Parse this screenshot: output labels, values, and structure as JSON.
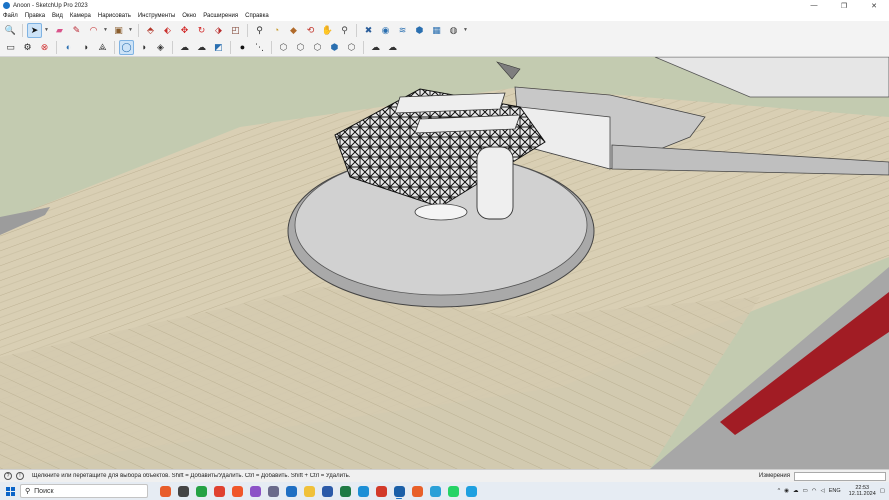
{
  "window": {
    "title": "Anoon - SketchUp Pro 2023",
    "minimize": "—",
    "maximize": "❐",
    "close": "✕"
  },
  "menu": [
    "Файл",
    "Правка",
    "Вид",
    "Камера",
    "Нарисовать",
    "Инструменты",
    "Окно",
    "Расширения",
    "Справка"
  ],
  "toolbar1": [
    {
      "name": "zoom-extents-icon",
      "glyph": "🔍",
      "color": "#333333"
    },
    {
      "name": "select-tool-icon",
      "glyph": "➤",
      "color": "#111111",
      "active": true
    },
    {
      "name": "eraser-icon",
      "glyph": "▰",
      "color": "#d9538a"
    },
    {
      "name": "pencil-line-icon",
      "glyph": "✎",
      "color": "#b8232f"
    },
    {
      "name": "arc-tool-icon",
      "glyph": "◠",
      "color": "#c22a2a"
    },
    {
      "name": "rectangle-tool-icon",
      "glyph": "▣",
      "color": "#8a5d2d"
    },
    {
      "name": "push-pull-icon",
      "glyph": "⬘",
      "color": "#b3372a"
    },
    {
      "name": "follow-me-icon",
      "glyph": "⬖",
      "color": "#c9302c"
    },
    {
      "name": "move-tool-icon",
      "glyph": "✥",
      "color": "#d22a2a"
    },
    {
      "name": "rotate-tool-icon",
      "glyph": "↻",
      "color": "#d22a2a"
    },
    {
      "name": "scale-tool-icon",
      "glyph": "⬗",
      "color": "#b82c2c"
    },
    {
      "name": "offset-tool-icon",
      "glyph": "◰",
      "color": "#7a3b2b"
    },
    {
      "name": "tape-measure-icon",
      "glyph": "⚲",
      "color": "#333333"
    },
    {
      "name": "protractor-icon",
      "glyph": "◔",
      "color": "#c79a2a"
    },
    {
      "name": "paint-bucket-icon",
      "glyph": "◆",
      "color": "#b06a2a"
    },
    {
      "name": "orbit-tool-icon",
      "glyph": "⟲",
      "color": "#c2342a"
    },
    {
      "name": "pan-tool-icon",
      "glyph": "✋",
      "color": "#7a4a2a"
    },
    {
      "name": "zoom-tool-icon",
      "glyph": "⚲",
      "color": "#444444"
    },
    {
      "name": "section-plane-icon",
      "glyph": "✖",
      "color": "#2a5d9a"
    },
    {
      "name": "3d-warehouse-icon",
      "glyph": "◉",
      "color": "#2a6fb0"
    },
    {
      "name": "extension-warehouse-icon",
      "glyph": "≋",
      "color": "#2a6fb0"
    },
    {
      "name": "layout-send-icon",
      "glyph": "⬢",
      "color": "#2a6fb0"
    },
    {
      "name": "extension-manager-icon",
      "glyph": "▦",
      "color": "#2a6fb0"
    },
    {
      "name": "user-account-icon",
      "glyph": "◍",
      "color": "#444444"
    }
  ],
  "toolbar2": [
    {
      "name": "open-folder-icon",
      "glyph": "▭",
      "color": "#333333"
    },
    {
      "name": "settings-gear-icon",
      "glyph": "⚙",
      "color": "#222222"
    },
    {
      "name": "cancel-circle-icon",
      "glyph": "⊗",
      "color": "#d03030"
    },
    {
      "name": "geo-location-icon",
      "glyph": "◐",
      "color": "#2a6fb0"
    },
    {
      "name": "add-location-icon",
      "glyph": "◑",
      "color": "#333333"
    },
    {
      "name": "terrain-icon",
      "glyph": "⟁",
      "color": "#333333"
    },
    {
      "name": "xray-mode-icon",
      "glyph": "◯",
      "color": "#2a6fb0",
      "active": true
    },
    {
      "name": "back-edges-icon",
      "glyph": "◑",
      "color": "#333333"
    },
    {
      "name": "wireframe-icon",
      "glyph": "◈",
      "color": "#333333"
    },
    {
      "name": "upload-cloud-icon",
      "glyph": "☁",
      "color": "#333333"
    },
    {
      "name": "download-cloud-icon",
      "glyph": "☁",
      "color": "#333333"
    },
    {
      "name": "share-model-icon",
      "glyph": "◩",
      "color": "#2a6fb0"
    },
    {
      "name": "point-dot-icon",
      "glyph": "●",
      "color": "#111111"
    },
    {
      "name": "dashed-line-icon",
      "glyph": "⋱",
      "color": "#333333"
    },
    {
      "name": "solid-tools-union-icon",
      "glyph": "⬡",
      "color": "#555555"
    },
    {
      "name": "solid-tools-subtract-icon",
      "glyph": "⬡",
      "color": "#555555"
    },
    {
      "name": "solid-tools-intersect-icon",
      "glyph": "⬡",
      "color": "#555555"
    },
    {
      "name": "solid-tools-trim-icon",
      "glyph": "⬢",
      "color": "#2a6fb0"
    },
    {
      "name": "solid-tools-split-icon",
      "glyph": "⬡",
      "color": "#555555"
    },
    {
      "name": "cloud-sync-icon",
      "glyph": "☁",
      "color": "#333333"
    },
    {
      "name": "cloud-export-icon",
      "glyph": "☁",
      "color": "#333333"
    }
  ],
  "status": {
    "help_icon": "?",
    "info_icon": "!",
    "text": "Щелкните или перетащите для выбора объектов. Shift = Добавить/Удалить. Ctrl = Добавить. Shift + Ctrl = Удалить.",
    "measure_label": "Измерения"
  },
  "taskbar": {
    "search_label": "Поиск",
    "apps": [
      {
        "name": "copilot-app-icon",
        "color": "#e85d2a"
      },
      {
        "name": "task-view-icon",
        "color": "#444444"
      },
      {
        "name": "whatsapp-store-icon",
        "color": "#25a244"
      },
      {
        "name": "chrome-icon",
        "color": "#e0412f"
      },
      {
        "name": "brave-browser-icon",
        "color": "#f0572a"
      },
      {
        "name": "app-purple-icon",
        "color": "#8c52c7"
      },
      {
        "name": "settings-app-icon",
        "color": "#6a6a8a"
      },
      {
        "name": "outlook-icon",
        "color": "#1f6fc3"
      },
      {
        "name": "file-explorer-icon",
        "color": "#f0c13a"
      },
      {
        "name": "word-icon",
        "color": "#2b5aa8"
      },
      {
        "name": "excel-icon",
        "color": "#1f7a45"
      },
      {
        "name": "edge-icon",
        "color": "#1c8fd6"
      },
      {
        "name": "store-icon",
        "color": "#d23a2a"
      },
      {
        "name": "sketchup-taskbar-icon",
        "color": "#1a5fa8",
        "open": true
      },
      {
        "name": "firefox-icon",
        "color": "#e8602a"
      },
      {
        "name": "telegram-icon",
        "color": "#2aa0d8"
      },
      {
        "name": "whatsapp-icon",
        "color": "#25d366"
      },
      {
        "name": "skype-icon",
        "color": "#1ea0e0"
      }
    ],
    "tray_chevron": "^",
    "lang": "ENG",
    "time": "22:53",
    "date": "12.11.2024"
  }
}
